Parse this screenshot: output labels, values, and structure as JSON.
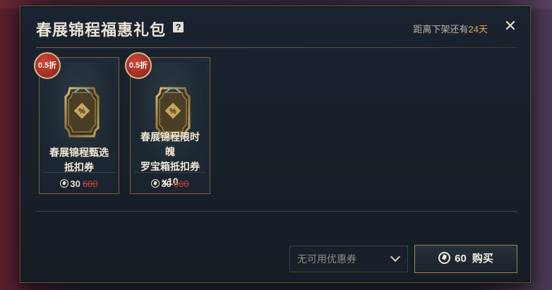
{
  "dialog": {
    "title": "春展锦程福惠礼包",
    "help_symbol": "?",
    "countdown_prefix": "距离下架还有",
    "countdown_days": "24天",
    "close_symbol": "✕"
  },
  "items": [
    {
      "badge": "0.5折",
      "name": "春展锦程甄选抵扣券",
      "price": "30",
      "original_price": "600",
      "icon": "discount-ticket-icon"
    },
    {
      "badge": "0.5折",
      "name_line1": "春展锦程限时魄",
      "name_line2": "罗宝箱抵扣券",
      "name_line3": "x10",
      "price": "30",
      "original_price": "600",
      "icon": "discount-ticket-icon"
    }
  ],
  "footer": {
    "coupon_placeholder": "无可用优惠券",
    "buy_amount": "60",
    "buy_label": "购买"
  },
  "colors": {
    "accent_gold": "#d4ac4a",
    "discount_red": "#c2453a"
  }
}
